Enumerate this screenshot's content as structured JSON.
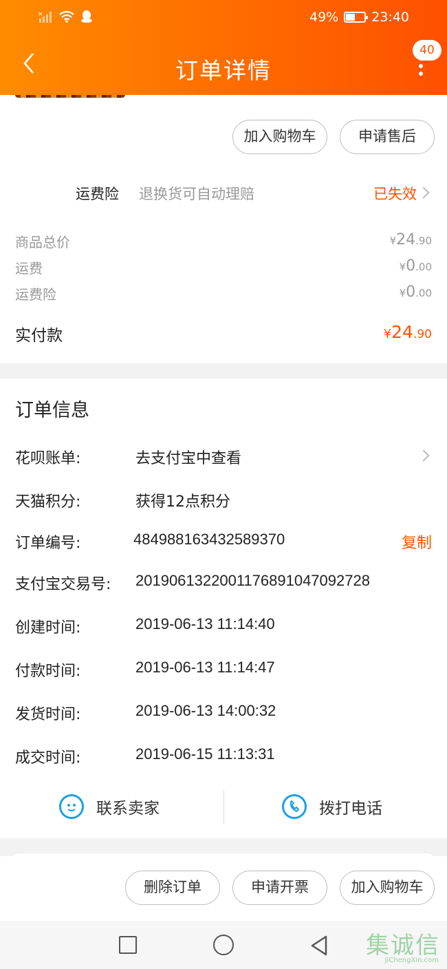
{
  "status": {
    "battery": "49%",
    "time": "23:40",
    "battery_level": 0.49
  },
  "header": {
    "title": "订单详情",
    "badge": "40"
  },
  "top_actions": {
    "add_cart": "加入购物车",
    "after_sales": "申请售后"
  },
  "insurance": {
    "label": "运费险",
    "desc": "退换货可自动理赔",
    "status": "已失效"
  },
  "price": {
    "rows": [
      {
        "label": "商品总价",
        "currency": "¥",
        "int": "24",
        "dec": ".90"
      },
      {
        "label": "运费",
        "currency": "¥",
        "int": "0",
        "dec": ".00"
      },
      {
        "label": "运费险",
        "currency": "¥",
        "int": "0",
        "dec": ".00"
      }
    ],
    "paid": {
      "label": "实付款",
      "currency": "¥",
      "int": "24",
      "dec": ".90"
    }
  },
  "order_info": {
    "title": "订单信息",
    "rows": [
      {
        "label": "花呗账单:",
        "value": "去支付宝中查看"
      },
      {
        "label": "天猫积分:",
        "value": "获得12点积分"
      },
      {
        "label": "订单编号:",
        "value": "484988163432589370",
        "action": "复制"
      },
      {
        "label": "支付宝交易号:",
        "value": "2019061322001176891047092728"
      },
      {
        "label": "创建时间:",
        "value": "2019-06-13 11:14:40"
      },
      {
        "label": "付款时间:",
        "value": "2019-06-13 11:14:47"
      },
      {
        "label": "发货时间:",
        "value": "2019-06-13 14:00:32"
      },
      {
        "label": "成交时间:",
        "value": "2019-06-15 11:13:31"
      }
    ]
  },
  "contact": {
    "seller": "联系卖家",
    "phone": "拨打电话"
  },
  "bottom_actions": {
    "delete": "删除订单",
    "invoice": "申请开票",
    "add_cart": "加入购物车"
  },
  "watermark": {
    "cn": "集诚信",
    "en": "JiChengXin.com"
  },
  "colors": {
    "accent": "#ff5000",
    "header_start": "#ff8c00",
    "icon_blue": "#1aa0e5"
  }
}
